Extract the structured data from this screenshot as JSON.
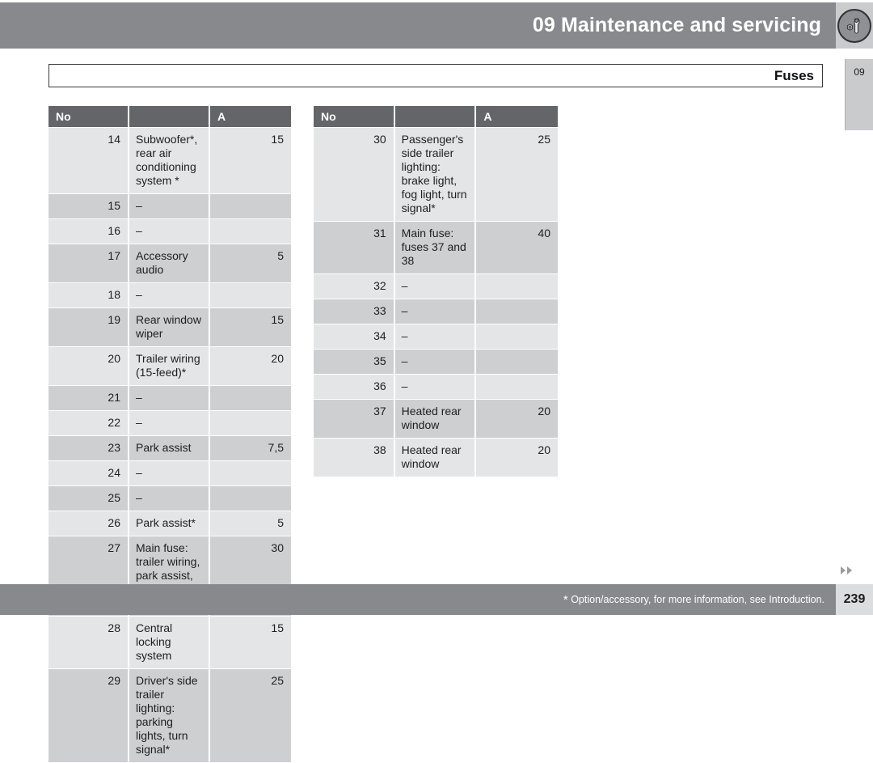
{
  "header": {
    "chapter_title": "09 Maintenance and servicing",
    "icon": "wrench-and-nut-icon"
  },
  "section": {
    "title": "Fuses"
  },
  "chapter_tab": {
    "label": "09"
  },
  "tables": {
    "columns": {
      "no": "No",
      "description": "",
      "amps": "A"
    },
    "left": [
      {
        "no": "14",
        "description": "Subwoofer*, rear air conditioning system *",
        "amps": "15"
      },
      {
        "no": "15",
        "description": "–",
        "amps": ""
      },
      {
        "no": "16",
        "description": "–",
        "amps": ""
      },
      {
        "no": "17",
        "description": "Accessory audio",
        "amps": "5"
      },
      {
        "no": "18",
        "description": "–",
        "amps": ""
      },
      {
        "no": "19",
        "description": "Rear window wiper",
        "amps": "15"
      },
      {
        "no": "20",
        "description": "Trailer wiring (15-feed)*",
        "amps": "20"
      },
      {
        "no": "21",
        "description": "–",
        "amps": ""
      },
      {
        "no": "22",
        "description": "–",
        "amps": ""
      },
      {
        "no": "23",
        "description": "Park assist",
        "amps": "7,5"
      },
      {
        "no": "24",
        "description": "–",
        "amps": ""
      },
      {
        "no": "25",
        "description": "–",
        "amps": ""
      },
      {
        "no": "26",
        "description": "Park assist*",
        "amps": "5"
      },
      {
        "no": "27",
        "description": "Main fuse: trailer wiring, park assist, All Wheel Drive",
        "amps": "30"
      },
      {
        "no": "28",
        "description": "Central locking system",
        "amps": "15"
      },
      {
        "no": "29",
        "description": "Driver's side trailer lighting: parking lights, turn signal*",
        "amps": "25"
      }
    ],
    "right": [
      {
        "no": "30",
        "description": "Passenger's side trailer lighting: brake light, fog light, turn signal*",
        "amps": "25"
      },
      {
        "no": "31",
        "description": "Main fuse: fuses 37 and 38",
        "amps": "40"
      },
      {
        "no": "32",
        "description": "–",
        "amps": ""
      },
      {
        "no": "33",
        "description": "–",
        "amps": ""
      },
      {
        "no": "34",
        "description": "–",
        "amps": ""
      },
      {
        "no": "35",
        "description": "–",
        "amps": ""
      },
      {
        "no": "36",
        "description": "–",
        "amps": ""
      },
      {
        "no": "37",
        "description": "Heated rear window",
        "amps": "20"
      },
      {
        "no": "38",
        "description": "Heated rear window",
        "amps": "20"
      }
    ]
  },
  "footer": {
    "note_star": "*",
    "note": "Option/accessory, for more information, see Introduction.",
    "page_number": "239"
  },
  "colors": {
    "band_gray": "#87898d",
    "table_header_gray": "#636569",
    "row_light": "#e4e5e7",
    "row_dark": "#cdcfd1",
    "tab_gray": "#c9cbcd",
    "page_box": "#dcdddf"
  }
}
